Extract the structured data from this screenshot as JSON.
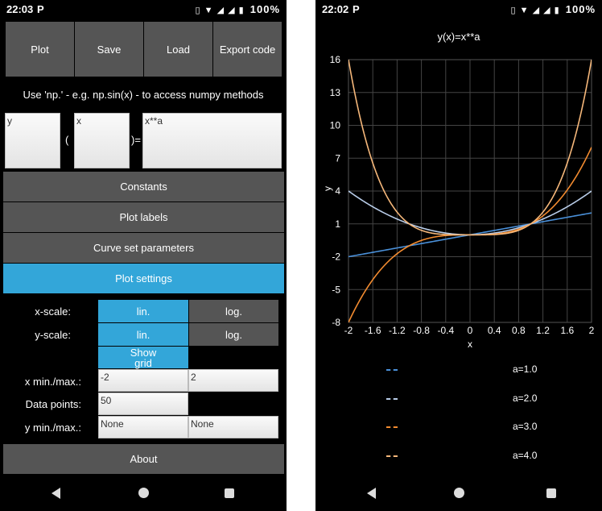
{
  "status_left": {
    "time": "22:03",
    "p": "P",
    "battery": "100%"
  },
  "status_right": {
    "time": "22:02",
    "p": "P",
    "battery": "100%"
  },
  "toolbar": {
    "plot": "Plot",
    "save": "Save",
    "load": "Load",
    "export": "Export code"
  },
  "hint": "Use 'np.' - e.g. np.sin(x) - to access numpy methods",
  "equation": {
    "y_var": "y",
    "open_paren": "(",
    "x_var": "x",
    "close_paren": ")=",
    "expression": "x**a"
  },
  "sections": {
    "constants": "Constants",
    "plot_labels": "Plot labels",
    "curve_set": "Curve set parameters",
    "plot_settings": "Plot settings",
    "about": "About"
  },
  "settings": {
    "x_scale_label": "x-scale:",
    "y_scale_label": "y-scale:",
    "lin": "lin.",
    "log": "log.",
    "show_grid": "Show grid",
    "x_minmax_label": "x min./max.:",
    "x_min": "-2",
    "x_max": "2",
    "data_points_label": "Data points:",
    "data_points": "50",
    "y_minmax_label": "y min./max.:",
    "y_min": "None",
    "y_max": "None"
  },
  "colors": {
    "accent": "#33a6d9",
    "button": "#555555",
    "c1": "#4a90d9",
    "c2": "#b8cce8",
    "c3": "#f28b30",
    "c4": "#f5b77a"
  },
  "chart_data": {
    "type": "line",
    "title": "y(x)=x**a",
    "xlabel": "x",
    "ylabel": "y",
    "xlim": [
      -2,
      2
    ],
    "ylim": [
      -8,
      16
    ],
    "xticks": [
      "-2",
      "-1.6",
      "-1.2",
      "-0.8",
      "-0.4",
      "0",
      "0.4",
      "0.8",
      "1.2",
      "1.6",
      "2"
    ],
    "yticks": [
      "16",
      "13",
      "10",
      "7",
      "4",
      "1",
      "-2",
      "-5",
      "-8"
    ],
    "grid": true,
    "legend": "below",
    "series": [
      {
        "name": "a=1.0",
        "a": 1,
        "color": "#4a90d9"
      },
      {
        "name": "a=2.0",
        "a": 2,
        "color": "#b8cce8"
      },
      {
        "name": "a=3.0",
        "a": 3,
        "color": "#f28b30"
      },
      {
        "name": "a=4.0",
        "a": 4,
        "color": "#f5b77a"
      }
    ]
  }
}
